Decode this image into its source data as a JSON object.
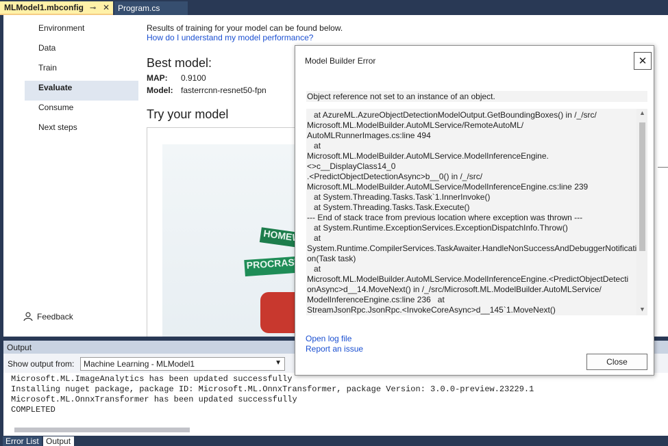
{
  "tabs": {
    "active": "MLModel1.mbconfig",
    "pin_glyph": "⊸",
    "close_glyph": "✕",
    "second": "Program.cs"
  },
  "nav": {
    "items": [
      {
        "label": "Environment"
      },
      {
        "label": "Data"
      },
      {
        "label": "Train"
      },
      {
        "label": "Evaluate"
      },
      {
        "label": "Consume"
      },
      {
        "label": "Next steps"
      }
    ],
    "selected": "Evaluate",
    "feedback": "Feedback"
  },
  "main": {
    "intro": "Results of training for your model can be found below.",
    "help_link": "How do I understand my model performance?",
    "best_model_title": "Best model:",
    "map_label": "MAP:",
    "map_value": "0.9100",
    "model_label": "Model:",
    "model_value": "fasterrcnn-resnet50-fpn",
    "try_title": "Try your model",
    "sign1": "HOMEWO",
    "sign2": "PROCRASTIN"
  },
  "output": {
    "title": "Output",
    "show_from_label": "Show output from:",
    "source": "Machine Learning - MLModel1",
    "lines": [
      "Microsoft.ML.ImageAnalytics has been updated successfully",
      "Installing nuget package, package ID: Microsoft.ML.OnnxTransformer, package Version: 3.0.0-preview.23229.1",
      "Microsoft.ML.OnnxTransformer has been updated successfully",
      "COMPLETED"
    ]
  },
  "bottom_tabs": [
    "Error List",
    "Output"
  ],
  "dialog": {
    "title": "Model Builder Error",
    "message": "Object reference not set to an instance of an object.",
    "trace": "   at AzureML.AzureObjectDetectionModelOutput.GetBoundingBoxes() in /_/src/\nMicrosoft.ML.ModelBuilder.AutoMLService/RemoteAutoML/\nAutoMLRunnerImages.cs:line 494\n   at\nMicrosoft.ML.ModelBuilder.AutoMLService.ModelInferenceEngine.<>c__DisplayClass14_0\n.<PredictObjectDetectionAsync>b__0() in /_/src/\nMicrosoft.ML.ModelBuilder.AutoMLService/ModelInferenceEngine.cs:line 239\n   at System.Threading.Tasks.Task`1.InnerInvoke()\n   at System.Threading.Tasks.Task.Execute()\n--- End of stack trace from previous location where exception was thrown ---\n   at System.Runtime.ExceptionServices.ExceptionDispatchInfo.Throw()\n   at\nSystem.Runtime.CompilerServices.TaskAwaiter.HandleNonSuccessAndDebuggerNotificati\non(Task task)\n   at\nMicrosoft.ML.ModelBuilder.AutoMLService.ModelInferenceEngine.<PredictObjectDetecti\nonAsync>d__14.MoveNext() in /_/src/Microsoft.ML.ModelBuilder.AutoMLService/\nModelInferenceEngine.cs:line 236   at\nStreamJsonRpc.JsonRpc.<InvokeCoreAsync>d__145`1.MoveNext()\n--- End of stack trace from previous location where exception was thrown ---",
    "open_log": "Open log file",
    "report": "Report an issue",
    "close_button": "Close",
    "close_glyph": "✕"
  },
  "colors": {
    "chrome": "#293955",
    "active_tab": "#fff1a8",
    "link": "#1a4fd1",
    "selected_nav": "#dfe6f0"
  }
}
